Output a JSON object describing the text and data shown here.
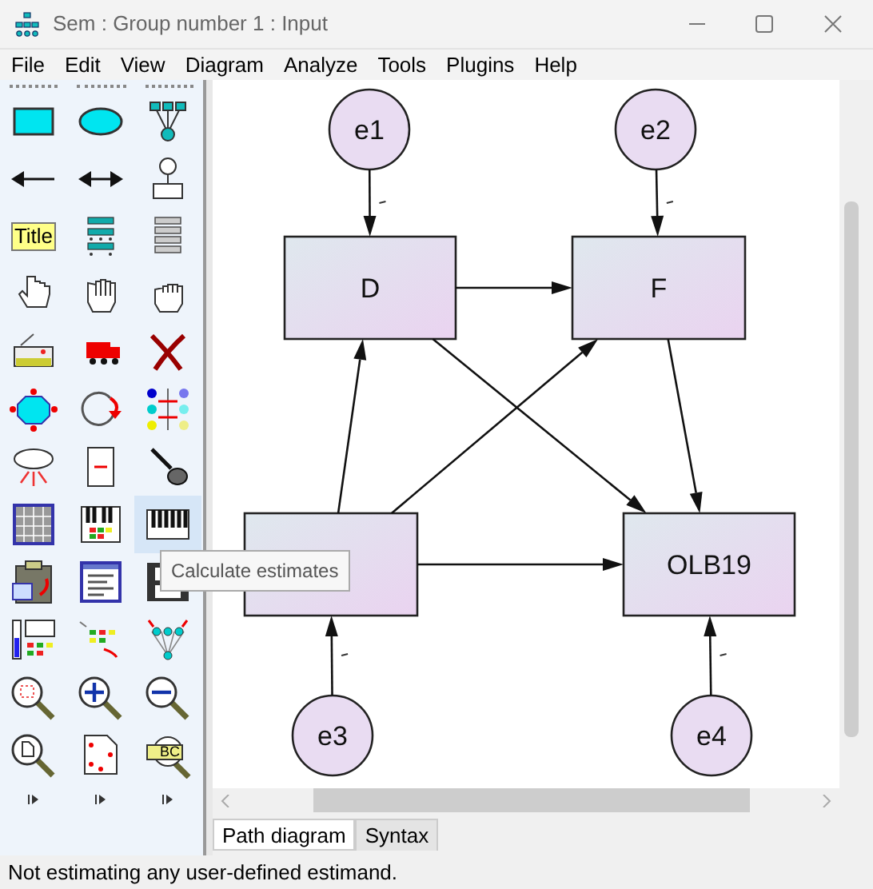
{
  "window": {
    "title": "Sem : Group number 1 : Input"
  },
  "menu": [
    "File",
    "Edit",
    "View",
    "Diagram",
    "Analyze",
    "Tools",
    "Plugins",
    "Help"
  ],
  "toolbox": {
    "tools": [
      {
        "highlighted": false
      },
      {
        "highlighted": false
      },
      {
        "highlighted": false
      },
      {
        "highlighted": false
      },
      {
        "highlighted": false
      },
      {
        "highlighted": false
      },
      {
        "highlighted": false,
        "label": "Title"
      },
      {
        "highlighted": false
      },
      {
        "highlighted": false
      },
      {
        "highlighted": false
      },
      {
        "highlighted": false
      },
      {
        "highlighted": false
      },
      {
        "highlighted": false
      },
      {
        "highlighted": false
      },
      {
        "highlighted": false
      },
      {
        "highlighted": false
      },
      {
        "highlighted": false
      },
      {
        "highlighted": false
      },
      {
        "highlighted": false
      },
      {
        "highlighted": false
      },
      {
        "highlighted": false
      },
      {
        "highlighted": false
      },
      {
        "highlighted": false
      },
      {
        "highlighted": true
      },
      {
        "highlighted": false
      },
      {
        "highlighted": false
      },
      {
        "highlighted": false
      },
      {
        "highlighted": false
      },
      {
        "highlighted": false
      },
      {
        "highlighted": false
      },
      {
        "highlighted": false
      },
      {
        "highlighted": false
      },
      {
        "highlighted": false
      },
      {
        "highlighted": false
      },
      {
        "highlighted": false
      },
      {
        "highlighted": false,
        "label": "BC"
      }
    ],
    "tooltip": "Calculate estimates"
  },
  "diagram": {
    "nodes": [
      {
        "kind": "error",
        "label": "e1"
      },
      {
        "kind": "error",
        "label": "e2"
      },
      {
        "kind": "observed",
        "label": "D"
      },
      {
        "kind": "observed",
        "label": "F"
      },
      {
        "kind": "observed"
      },
      {
        "kind": "observed",
        "label": "OLB19"
      },
      {
        "kind": "error",
        "label": "e3"
      },
      {
        "kind": "error",
        "label": "e4"
      }
    ]
  },
  "tabs": [
    {
      "label": "Path diagram",
      "selected": true
    },
    {
      "label": "Syntax",
      "selected": false
    }
  ],
  "status_bar": "Not estimating any user-defined estimand."
}
